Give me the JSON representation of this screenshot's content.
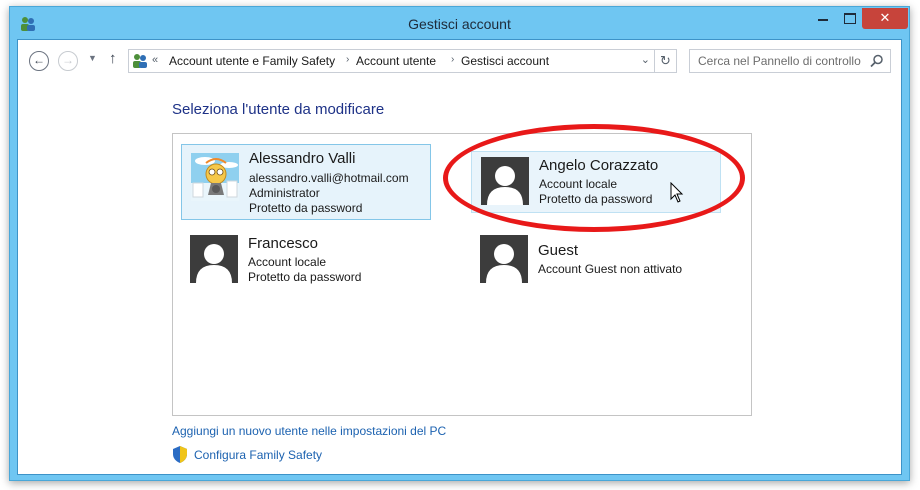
{
  "window": {
    "title": "Gestisci account"
  },
  "navbar": {
    "breadcrumbs_overflow": "«",
    "breadcrumbs": [
      "Account utente e Family Safety",
      "Account utente",
      "Gestisci account"
    ],
    "breadcrumb_separator": "›",
    "search_placeholder": "Cerca nel Pannello di controllo"
  },
  "content": {
    "heading": "Seleziona l'utente da modificare",
    "accounts": [
      {
        "name": "Alessandro Valli",
        "lines": [
          "alessandro.valli@hotmail.com",
          "Administrator",
          "Protetto da password"
        ],
        "picture": "cartoon-avatar",
        "state": "selected"
      },
      {
        "name": "Angelo Corazzato",
        "lines": [
          "Account locale",
          "Protetto da password"
        ],
        "picture": "default-user-silhouette",
        "state": "hovered"
      },
      {
        "name": "Francesco",
        "lines": [
          "Account locale",
          "Protetto da password"
        ],
        "picture": "default-user-silhouette",
        "state": "normal"
      },
      {
        "name": "Guest",
        "lines": [
          "Account Guest non attivato"
        ],
        "picture": "default-user-silhouette",
        "state": "normal"
      }
    ],
    "add_user_link": "Aggiungi un nuovo utente nelle impostazioni del PC",
    "family_safety_link": "Configura Family Safety"
  },
  "colors": {
    "window_frame": "#6fc6f2",
    "heading": "#1e3287",
    "link": "#1c62b0",
    "highlight_ellipse": "#e81919",
    "close_button": "#c7443b"
  }
}
